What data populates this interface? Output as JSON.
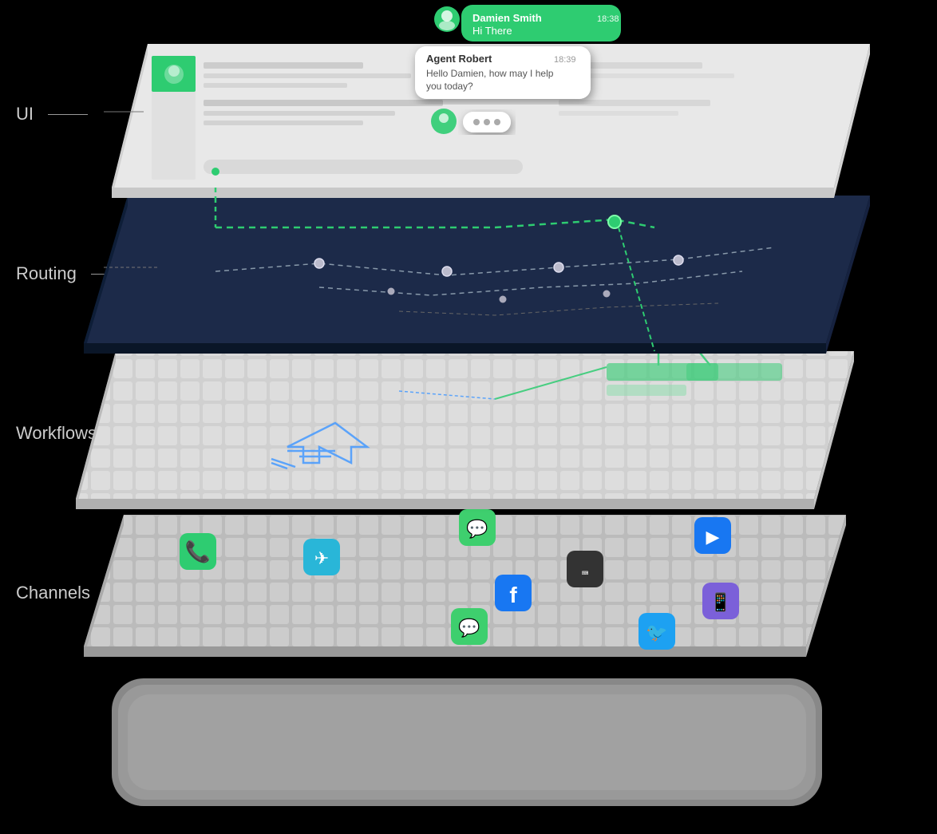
{
  "labels": {
    "ui": "UI",
    "routing": "Routing",
    "workflows": "Workflows",
    "channels": "Channels"
  },
  "chat": {
    "sent_name": "Damien Smith",
    "sent_time": "18:38",
    "sent_msg": "Hi There",
    "received_name": "Agent Robert",
    "received_time": "18:39",
    "received_msg": "Hello Damien, how may I help you today?"
  },
  "channels": {
    "icons": [
      {
        "name": "phone",
        "color": "#2ecc71",
        "symbol": "📞"
      },
      {
        "name": "telegram",
        "color": "#29b6d8",
        "symbol": "✈"
      },
      {
        "name": "wechat",
        "color": "#3ecf6e",
        "symbol": "💬"
      },
      {
        "name": "facebook",
        "color": "#1877f2",
        "symbol": "f"
      },
      {
        "name": "blackberry",
        "color": "#333",
        "symbol": "⌨"
      },
      {
        "name": "video",
        "color": "#1877f2",
        "symbol": "▶"
      },
      {
        "name": "viber",
        "color": "#7b60d9",
        "symbol": "📞"
      },
      {
        "name": "twitter",
        "color": "#1da1f2",
        "symbol": "🐦"
      },
      {
        "name": "chat",
        "color": "#2ecc71",
        "symbol": "💬"
      }
    ]
  },
  "colors": {
    "background": "#000000",
    "ui_layer": "#e8e8e8",
    "routing_layer": "#1a2a4a",
    "workflows_layer": "#d8d8d8",
    "channels_layer": "#cccccc",
    "green_accent": "#2ecc71",
    "blue_accent": "#4488ff",
    "line_color": "#555",
    "dashed_green": "#2ecc71",
    "dashed_white": "#aaaaaa"
  }
}
